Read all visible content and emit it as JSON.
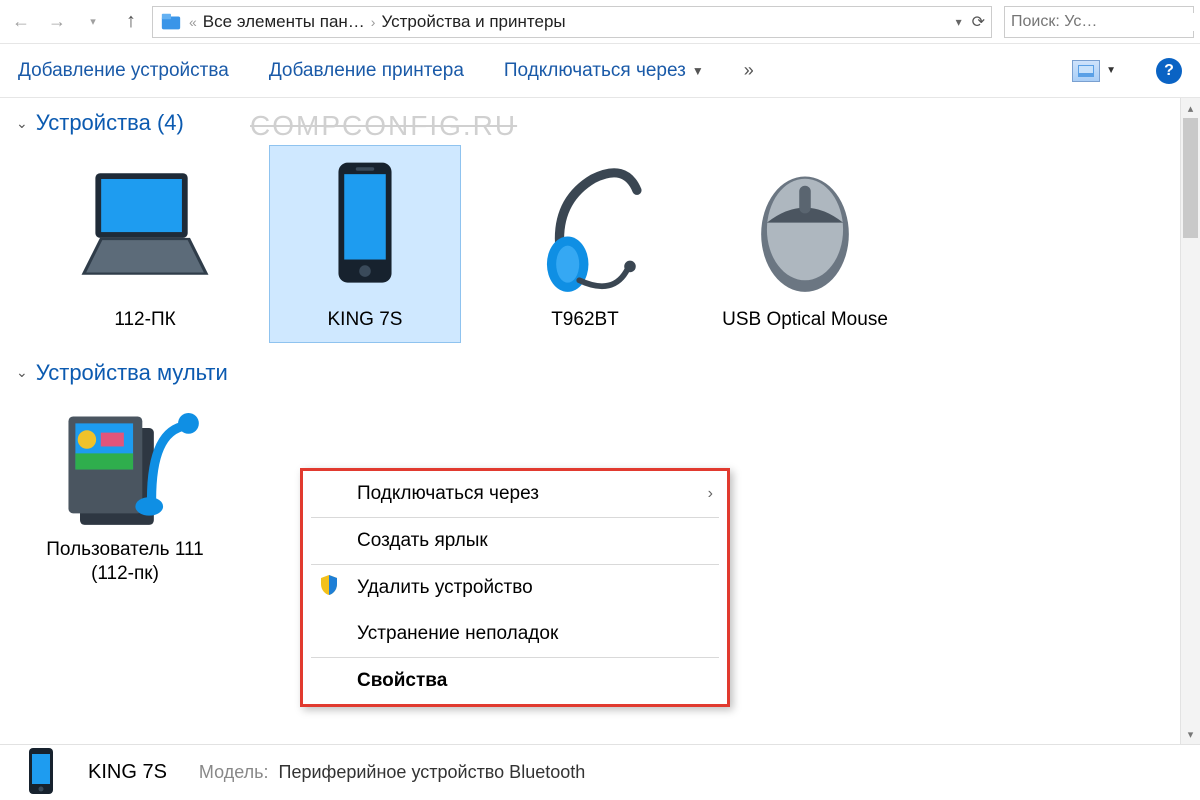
{
  "addressbar": {
    "crumb1": "Все элементы пан…",
    "crumb2": "Устройства и принтеры",
    "search_placeholder": "Поиск: Ус…"
  },
  "toolbar": {
    "add_device": "Добавление устройства",
    "add_printer": "Добавление принтера",
    "connect_via": "Подключаться через",
    "overflow": "»"
  },
  "watermark": "COMPCONFIG.RU",
  "groups": [
    {
      "title": "Устройства (4)"
    },
    {
      "title": "Устройства мульти"
    }
  ],
  "devices": [
    {
      "name": "112-ПК",
      "icon": "laptop"
    },
    {
      "name": "KING 7S",
      "icon": "phone",
      "selected": true
    },
    {
      "name": "T962BT",
      "icon": "headset"
    },
    {
      "name": "USB Optical Mouse",
      "icon": "mouse"
    }
  ],
  "media_devices": [
    {
      "name": "Пользователь 111 (112-пк)",
      "icon": "mediabox"
    }
  ],
  "context_menu": {
    "connect_via": "Подключаться через",
    "create_shortcut": "Создать ярлык",
    "remove_device": "Удалить устройство",
    "troubleshoot": "Устранение неполадок",
    "properties": "Свойства"
  },
  "details": {
    "name": "KING 7S",
    "model_label": "Модель:",
    "model_value": "Периферийное устройство Bluetooth"
  }
}
